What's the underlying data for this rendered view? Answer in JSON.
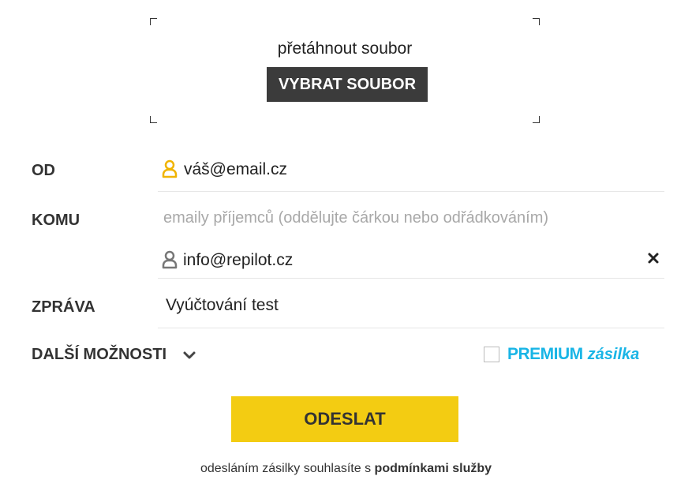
{
  "upload": {
    "drop_text": "přetáhnout soubor",
    "choose_button": "VYBRAT SOUBOR"
  },
  "form": {
    "from_label": "OD",
    "from_value": "váš@email.cz",
    "to_label": "KOMU",
    "to_placeholder": "emaily příjemců (oddělujte čárkou nebo odřádkováním)",
    "recipients": [
      {
        "email": "info@repilot.cz"
      }
    ],
    "message_label": "ZPRÁVA",
    "message_value": "Vyúčtování test"
  },
  "options": {
    "more_label": "DALŠÍ MOŽNOSTI",
    "premium_main": "PREMIUM",
    "premium_sub": "zásilka",
    "premium_checked": false
  },
  "actions": {
    "send_label": "ODESLAT"
  },
  "terms": {
    "prefix": "odesláním zásilky souhlasíte s",
    "link": "podmínkami služby"
  },
  "colors": {
    "accent_yellow": "#f3cc12",
    "dark_button": "#3b3b3b",
    "premium_blue": "#19b5e6",
    "user_icon_yellow": "#f0b400",
    "user_icon_gray": "#777777"
  },
  "icons": {
    "from_icon": "user-icon",
    "recipient_icon": "user-icon",
    "remove_icon": "close-icon",
    "more_icon": "chevron-down-icon"
  }
}
